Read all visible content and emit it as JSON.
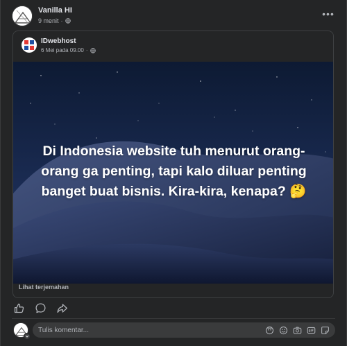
{
  "post": {
    "author": "Vanilla HI",
    "time": "9 menit",
    "more_label": "•••"
  },
  "shared": {
    "page_name": "IDwebhost",
    "time": "6 Mei pada 09.00",
    "image_text": "Di Indonesia website tuh menurut orang-orang ga penting, tapi kalo diluar penting banget buat bisnis. Kira-kira, kenapa? 🤔",
    "translate_label": "Lihat terjemahan"
  },
  "actions": {
    "icons": [
      "like-icon",
      "comment-icon",
      "share-icon"
    ]
  },
  "comment": {
    "placeholder": "Tulis komentar...",
    "tool_icons": [
      "avatar-sticker-icon",
      "emoji-icon",
      "camera-icon",
      "gif-icon",
      "sticker-icon"
    ]
  },
  "colors": {
    "background": "#242526",
    "text": "#e4e6eb",
    "secondary_text": "#b0b3b8",
    "border": "#3e4042",
    "sky_top": "#0d1a33",
    "dune": "#2c3a63"
  }
}
